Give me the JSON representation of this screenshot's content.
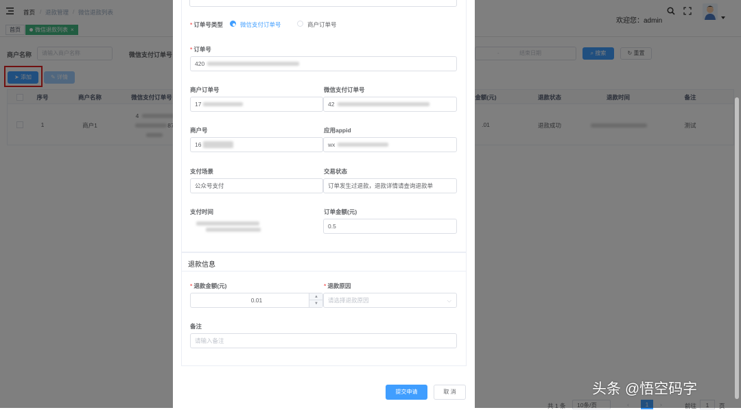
{
  "header": {
    "breadcrumb": [
      "首页",
      "退款管理",
      "微信退款列表"
    ],
    "welcome": "欢迎您：admin"
  },
  "tags": [
    "首页",
    "微信退款列表"
  ],
  "filters": {
    "merchant_label": "商户名称",
    "merchant_placeholder": "请输入商户名称",
    "wx_order_label": "微信支付订单号",
    "date_separator": "-",
    "date_end_placeholder": "结束日期",
    "search": "搜索",
    "reset": "重置"
  },
  "actions": {
    "add": "添加",
    "detail": "详情"
  },
  "table": {
    "headers_left": [
      "序号",
      "商户名称",
      "微信支付订单号"
    ],
    "headers_right": [
      "金额(元)",
      "退款状态",
      "退款时间",
      "备注"
    ],
    "row": {
      "index": "1",
      "merchant": "商户1",
      "wx_a": "4",
      "wx_b": "87",
      "amount": ".01",
      "status": "退款成功",
      "remark": "测试"
    }
  },
  "pagination": {
    "total": "共 1 条",
    "per_page": "10条/页",
    "page": "1",
    "goto": "前往",
    "goto_page": "1",
    "suffix": "页"
  },
  "form": {
    "order_type_label": "订单号类型",
    "order_type_options": [
      "微信支付订单号",
      "商户订单号"
    ],
    "order_no_label": "订单号",
    "order_no_value": "420",
    "merchant_order_label": "商户订单号",
    "merchant_order_value": "17",
    "wx_order_label": "微信支付订单号",
    "wx_order_value": "42",
    "merchant_no_label": "商户号",
    "merchant_no_value": "16",
    "appid_label": "应用appid",
    "appid_value": "wx",
    "pay_scene_label": "支付场景",
    "pay_scene_value": "公众号支付",
    "trade_state_label": "交易状态",
    "trade_state_value": "订单发生过退款，退款详情请查询退款单",
    "pay_time_label": "支付时间",
    "order_amount_label": "订单金额(元)",
    "order_amount_value": "0.5",
    "refund_section": "退款信息",
    "refund_amount_label": "退款金额(元)",
    "refund_amount_value": "0.01",
    "refund_reason_label": "退款原因",
    "refund_reason_placeholder": "请选择退款原因",
    "remark_label": "备注",
    "remark_placeholder": "请输入备注",
    "submit": "提交申请",
    "cancel": "取 消"
  },
  "watermark": "头条 @悟空码字",
  "colors": {
    "primary": "#409eff",
    "required": "#f56c6c",
    "tag_active": "#42b983",
    "highlight": "#e02020"
  }
}
